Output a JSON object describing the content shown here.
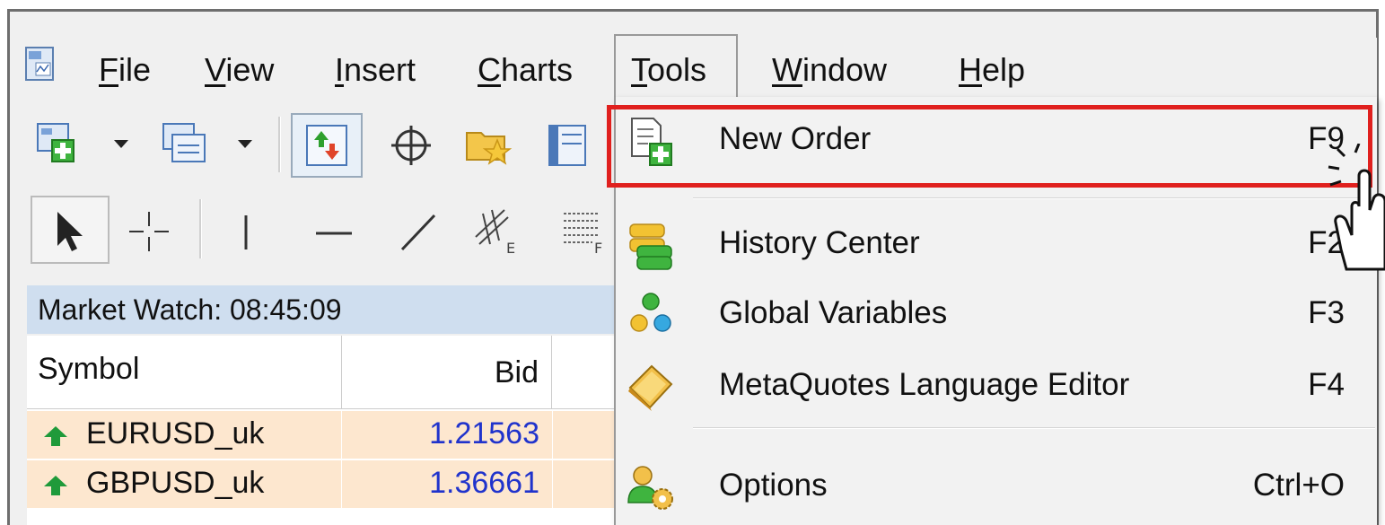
{
  "menu": {
    "file": "File",
    "file_ul": "F",
    "file_rest": "ile",
    "view_ul": "V",
    "view_rest": "iew",
    "insert_ul": "I",
    "insert_rest": "nsert",
    "charts_ul": "C",
    "charts_rest": "harts",
    "tools_ul": "T",
    "tools_rest": "ools",
    "window_ul": "W",
    "window_rest": "indow",
    "help_ul": "H",
    "help_rest": "elp"
  },
  "market_watch": {
    "title": "Market Watch: 08:45:09",
    "columns": {
      "symbol": "Symbol",
      "bid": "Bid"
    },
    "rows": [
      {
        "symbol": "EURUSD_uk",
        "bid": "1.21563"
      },
      {
        "symbol": "GBPUSD_uk",
        "bid": "1.36661"
      }
    ]
  },
  "tools_menu": {
    "items": [
      {
        "label": "New Order",
        "shortcut": "F9",
        "icon": "new-order-icon"
      },
      {
        "label": "History Center",
        "shortcut": "F2",
        "icon": "history-center-icon"
      },
      {
        "label": "Global Variables",
        "shortcut": "F3",
        "icon": "global-variables-icon"
      },
      {
        "label": "MetaQuotes Language Editor",
        "shortcut": "F4",
        "icon": "metaeditor-icon"
      },
      {
        "label": "Options",
        "shortcut": "Ctrl+O",
        "icon": "options-icon"
      }
    ]
  },
  "colors": {
    "highlight": "#e0201e",
    "bid_text": "#2033cc",
    "row_bg": "#fde7cf",
    "title_bg": "#cfdeef"
  }
}
